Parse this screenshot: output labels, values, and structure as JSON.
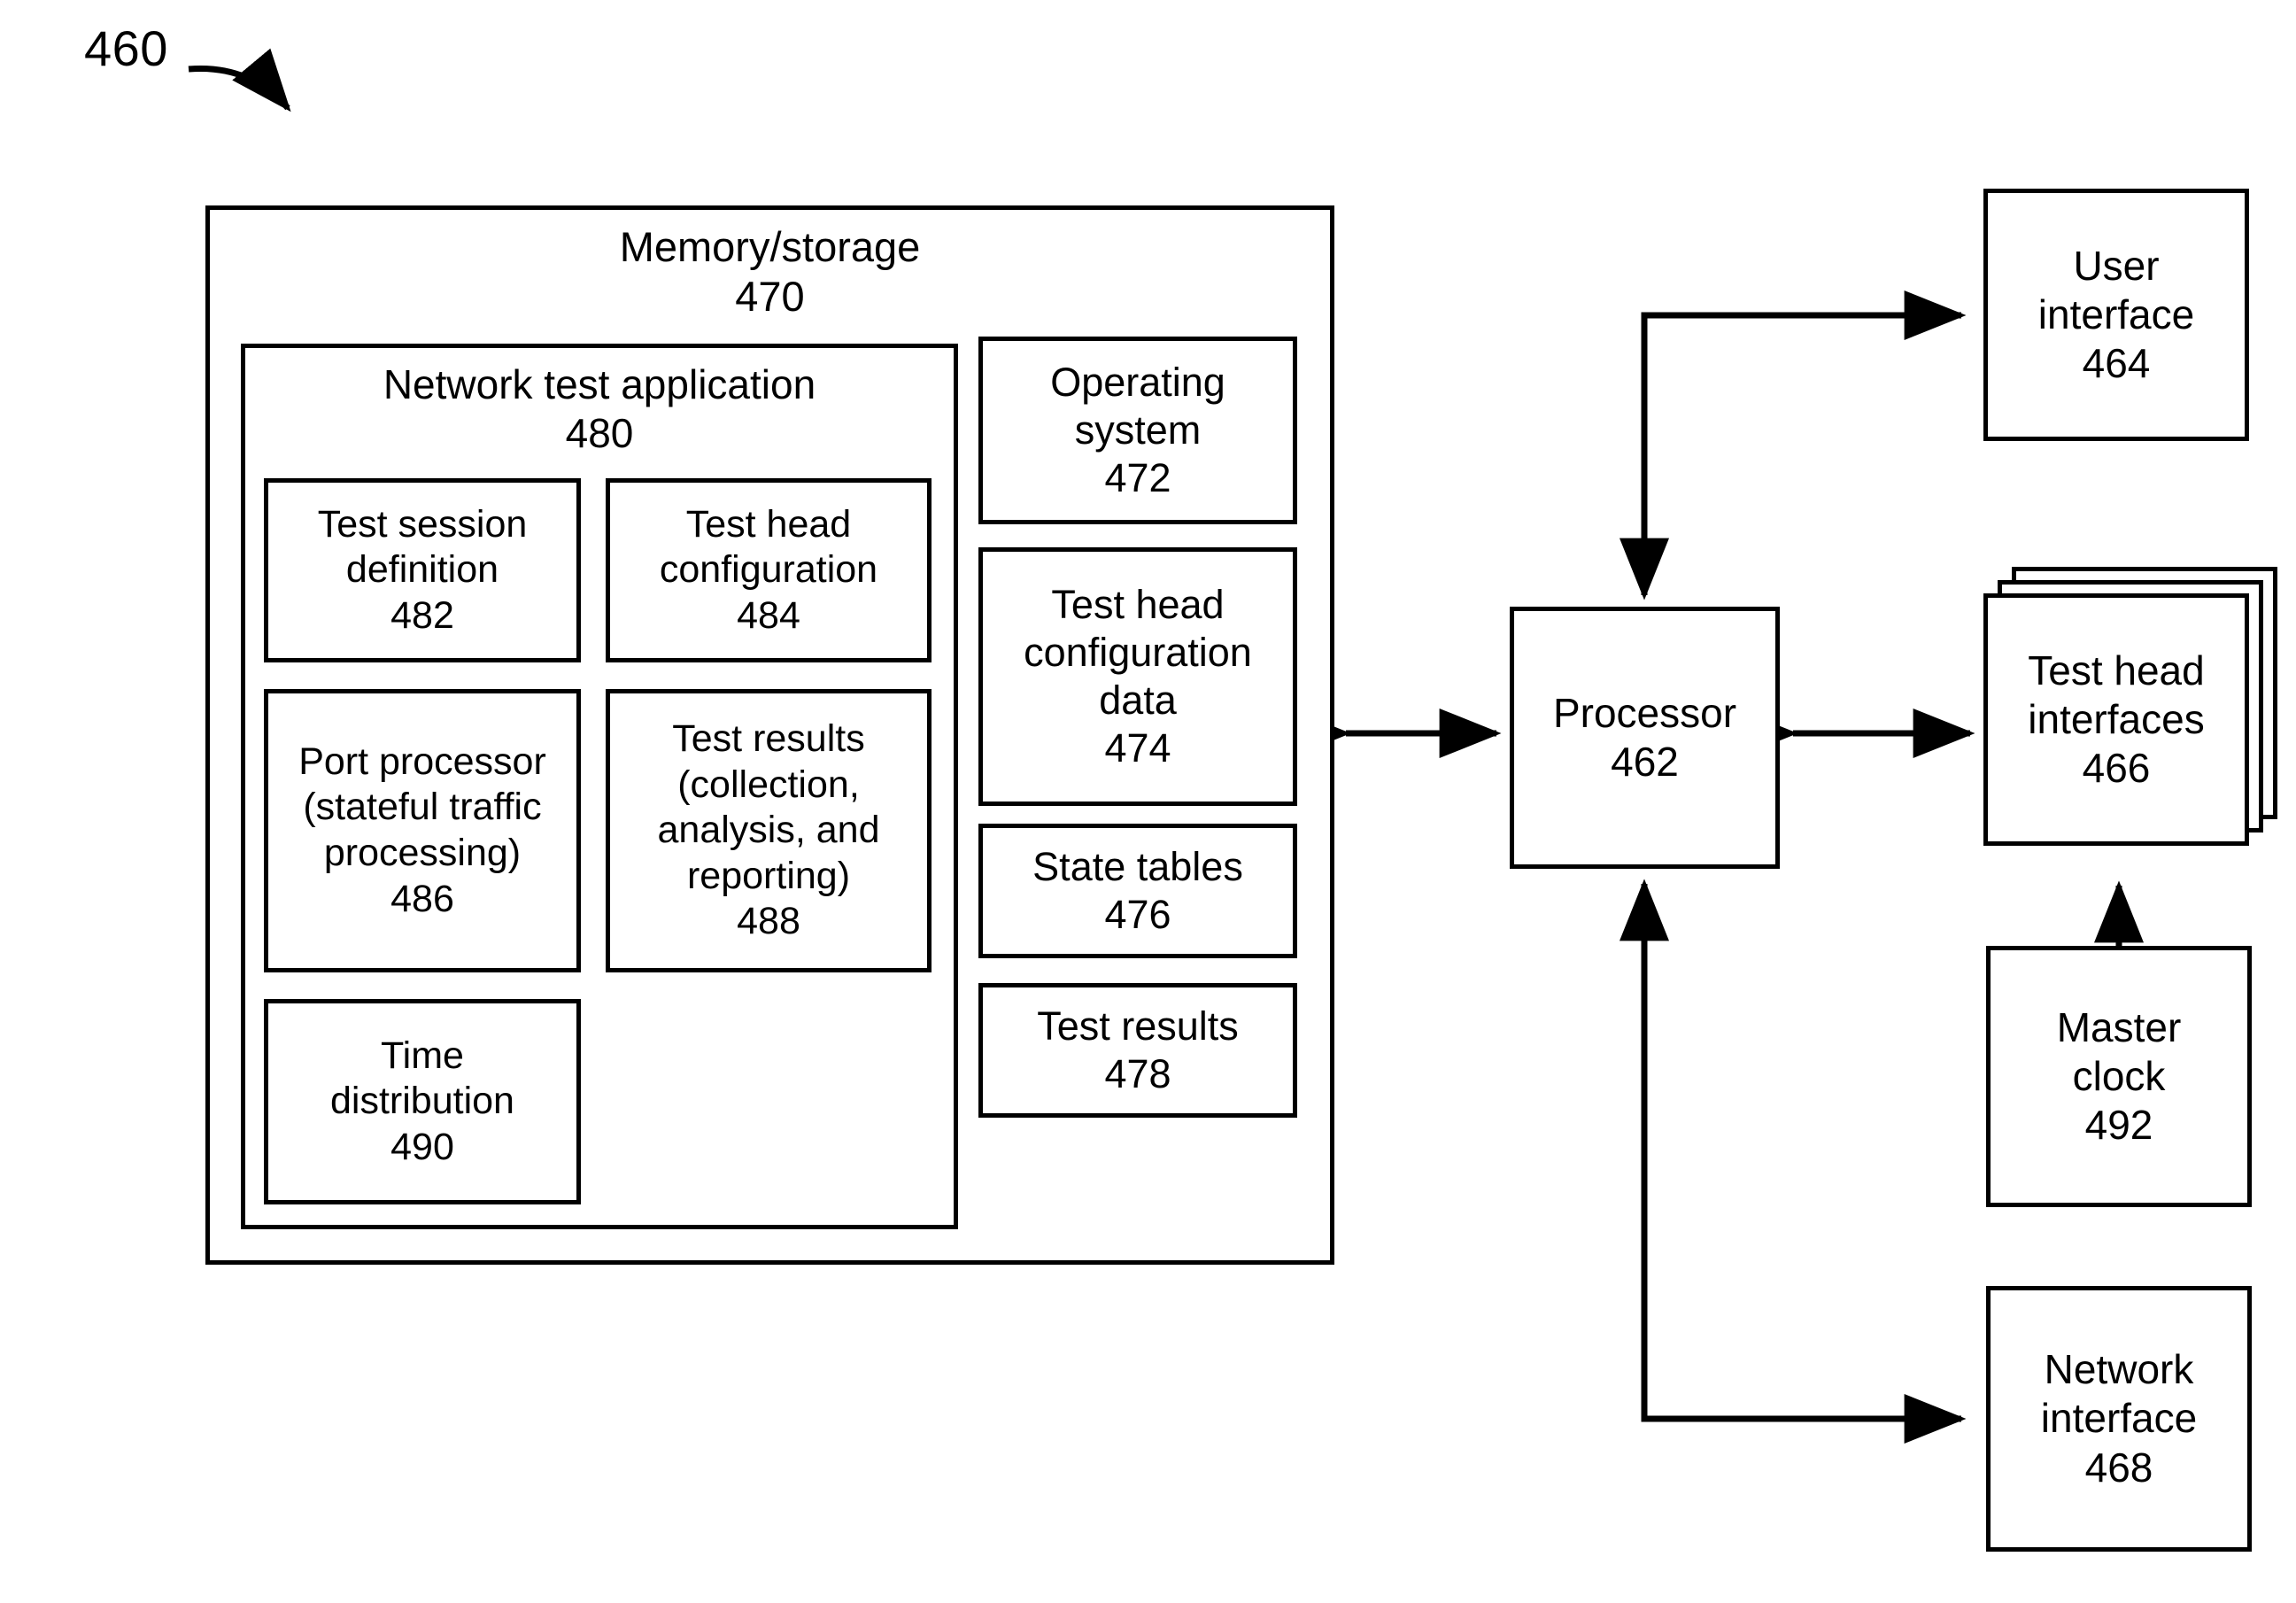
{
  "figure": {
    "reference_number": "460"
  },
  "memory_storage": {
    "title": "Memory/storage",
    "number": "470"
  },
  "network_test_application": {
    "title": "Network test application",
    "number": "480",
    "modules": [
      {
        "title": "Test session\ndefinition",
        "number": "482"
      },
      {
        "title": "Test head\nconfiguration",
        "number": "484"
      },
      {
        "title": "Port processor\n(stateful traffic\nprocessing)",
        "number": "486"
      },
      {
        "title": "Test results\n(collection,\nanalysis, and\nreporting)",
        "number": "488"
      },
      {
        "title": "Time\ndistribution",
        "number": "490"
      }
    ]
  },
  "memory_blocks": [
    {
      "title": "Operating\nsystem",
      "number": "472"
    },
    {
      "title": "Test head\nconfiguration\ndata",
      "number": "474"
    },
    {
      "title": "State tables",
      "number": "476"
    },
    {
      "title": "Test results",
      "number": "478"
    }
  ],
  "processor": {
    "title": "Processor",
    "number": "462"
  },
  "peripherals": [
    {
      "title": "User\ninterface",
      "number": "464"
    },
    {
      "title": "Test head\ninterfaces",
      "number": "466"
    },
    {
      "title": "Master\nclock",
      "number": "492"
    },
    {
      "title": "Network\ninterface",
      "number": "468"
    }
  ],
  "style": {
    "line_color": "#000000",
    "background_color": "#ffffff"
  }
}
